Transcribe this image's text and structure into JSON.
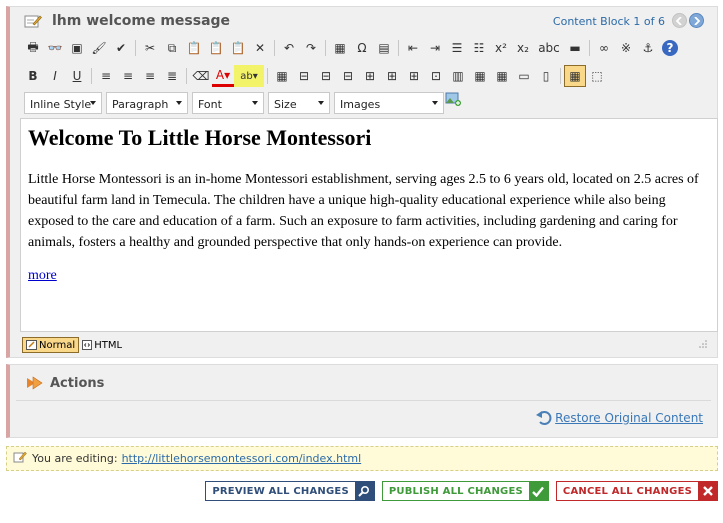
{
  "block": {
    "title": "lhm welcome message",
    "counter": "Content Block 1 of 6"
  },
  "toolbar": {
    "row1": [
      {
        "name": "print-icon",
        "glyph": "🖶"
      },
      {
        "name": "find-icon",
        "glyph": "👓"
      },
      {
        "name": "preview-icon",
        "glyph": "▣"
      },
      {
        "name": "spellcheck-brush-icon",
        "glyph": "🖌"
      },
      {
        "name": "spellcheck-icon",
        "glyph": "✔"
      },
      {
        "name": "cut-icon",
        "glyph": "✂"
      },
      {
        "name": "copy-icon",
        "glyph": "⧉"
      },
      {
        "name": "paste-icon",
        "glyph": "📋"
      },
      {
        "name": "paste-text-icon",
        "glyph": "📋"
      },
      {
        "name": "paste-word-icon",
        "glyph": "📋"
      },
      {
        "name": "remove-format-icon",
        "glyph": "✕"
      },
      {
        "name": "undo-icon",
        "glyph": "↶"
      },
      {
        "name": "redo-icon",
        "glyph": "↷"
      },
      {
        "name": "insert-image-icon",
        "glyph": "▦"
      },
      {
        "name": "special-char-icon",
        "glyph": "Ω"
      },
      {
        "name": "insert-snippet-icon",
        "glyph": "▤"
      },
      {
        "name": "outdent-icon",
        "glyph": "⇤"
      },
      {
        "name": "indent-icon",
        "glyph": "⇥"
      },
      {
        "name": "ordered-list-icon",
        "glyph": "☰"
      },
      {
        "name": "unordered-list-icon",
        "glyph": "☷"
      },
      {
        "name": "superscript-icon",
        "glyph": "x²"
      },
      {
        "name": "subscript-icon",
        "glyph": "x₂"
      },
      {
        "name": "strikethrough-icon",
        "glyph": "abc"
      },
      {
        "name": "horizontal-rule-icon",
        "glyph": "▬"
      },
      {
        "name": "link-icon",
        "glyph": "∞"
      },
      {
        "name": "unlink-icon",
        "glyph": "※"
      },
      {
        "name": "anchor-icon",
        "glyph": "⚓"
      },
      {
        "name": "help-icon",
        "glyph": "?"
      }
    ],
    "row2": [
      {
        "name": "bold-icon",
        "glyph": "B"
      },
      {
        "name": "italic-icon",
        "glyph": "I"
      },
      {
        "name": "underline-icon",
        "glyph": "U"
      },
      {
        "name": "align-left-icon",
        "glyph": "≡"
      },
      {
        "name": "align-center-icon",
        "glyph": "≡"
      },
      {
        "name": "align-right-icon",
        "glyph": "≡"
      },
      {
        "name": "align-justify-icon",
        "glyph": "≣"
      },
      {
        "name": "eraser-icon",
        "glyph": "⌫"
      },
      {
        "name": "font-color-icon",
        "glyph": "A▾"
      },
      {
        "name": "highlight-color-icon",
        "glyph": "ab▾"
      },
      {
        "name": "insert-table-icon",
        "glyph": "▦"
      },
      {
        "name": "insert-row-before-icon",
        "glyph": "⊟"
      },
      {
        "name": "insert-row-after-icon",
        "glyph": "⊟"
      },
      {
        "name": "delete-row-icon",
        "glyph": "⊟"
      },
      {
        "name": "insert-column-before-icon",
        "glyph": "⊞"
      },
      {
        "name": "insert-column-after-icon",
        "glyph": "⊞"
      },
      {
        "name": "delete-column-icon",
        "glyph": "⊞"
      },
      {
        "name": "merge-cells-icon",
        "glyph": "⊡"
      },
      {
        "name": "split-cell-icon",
        "glyph": "▥"
      },
      {
        "name": "table-properties-icon",
        "glyph": "▦"
      },
      {
        "name": "cell-properties-icon",
        "glyph": "▦"
      },
      {
        "name": "row-properties-icon",
        "glyph": "▭"
      },
      {
        "name": "column-properties-icon",
        "glyph": "▯"
      },
      {
        "name": "show-borders-icon",
        "glyph": "▦"
      },
      {
        "name": "show-blocks-icon",
        "glyph": "⬚"
      }
    ]
  },
  "dropdowns": [
    {
      "name": "inline-style-select",
      "label": "Inline Style",
      "width": 78
    },
    {
      "name": "paragraph-format-select",
      "label": "Paragraph",
      "width": 82
    },
    {
      "name": "font-select",
      "label": "Font",
      "width": 72
    },
    {
      "name": "size-select",
      "label": "Size",
      "width": 62
    },
    {
      "name": "images-select",
      "label": "Images",
      "width": 110
    }
  ],
  "editor": {
    "heading": "Welcome To Little Horse Montessori",
    "paragraph": "Little Horse Montessori is an in-home Montessori establishment, serving ages 2.5 to 6 years old, located on 2.5 acres of beautiful farm land in Temecula. The children have a unique high-quality educational experience while also being exposed to the care and education of a farm. Such an exposure to farm activities, including gardening and caring for animals, fosters a healthy and grounded perspective that only hands-on experience can provide.",
    "more_link": "more"
  },
  "modes": {
    "normal": "Normal",
    "html": "HTML"
  },
  "actions": {
    "title": "Actions",
    "restore_label": "Restore Original Content"
  },
  "notice": {
    "prefix": "You are editing:",
    "url": "http://littlehorsemontessori.com/index.html"
  },
  "buttons": {
    "preview": "PREVIEW ALL CHANGES",
    "publish": "PUBLISH ALL CHANGES",
    "cancel": "CANCEL ALL CHANGES"
  },
  "colors": {
    "accent_blue": "#2b6aa8",
    "panel_left_border": "#d9a4a4",
    "publish_green": "#3f9a3a",
    "cancel_red": "#c0282a",
    "preview_navy": "#2f4f7a"
  }
}
